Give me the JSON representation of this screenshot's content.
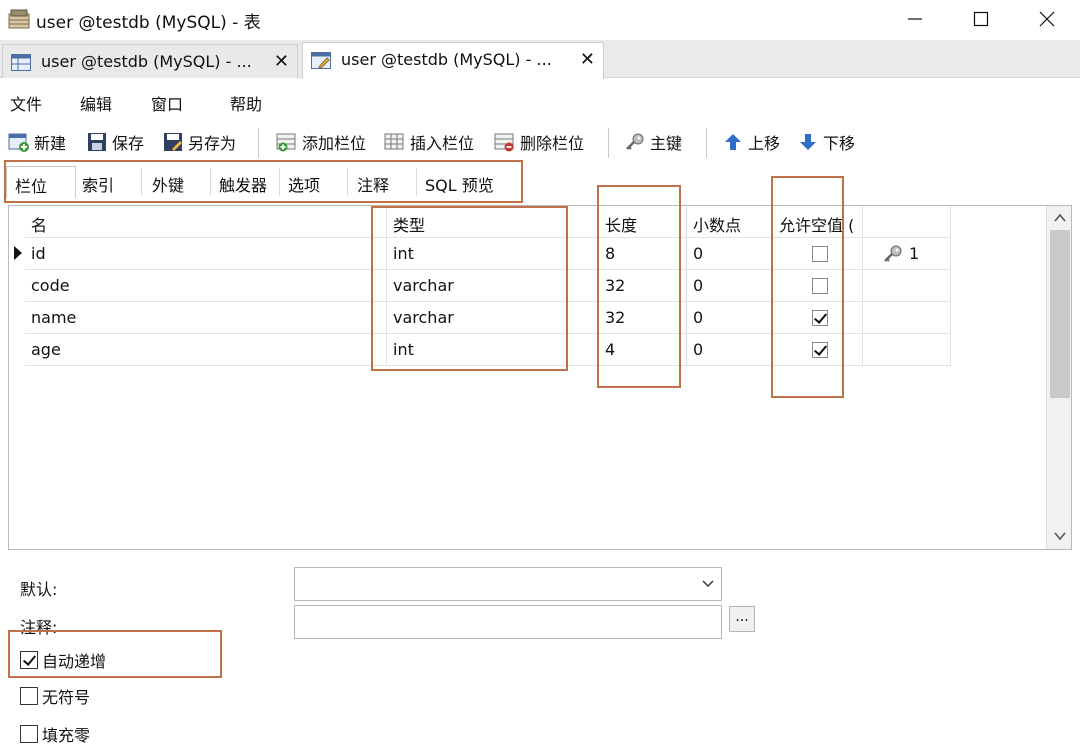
{
  "window": {
    "title": "user @testdb (MySQL) - 表"
  },
  "tabs": [
    {
      "label": "user @testdb (MySQL) - ...",
      "close": "✕"
    },
    {
      "label": "user @testdb (MySQL) - ...",
      "close": "✕"
    }
  ],
  "menu": [
    "文件",
    "编辑",
    "窗口",
    "帮助"
  ],
  "toolbar": {
    "new": "新建",
    "save": "保存",
    "save_as": "另存为",
    "add_column": "添加栏位",
    "insert_column": "插入栏位",
    "delete_column": "删除栏位",
    "primary_key": "主键",
    "move_up": "上移",
    "move_down": "下移"
  },
  "subtabs": [
    "栏位",
    "索引",
    "外键",
    "触发器",
    "选项",
    "注释",
    "SQL 预览"
  ],
  "grid": {
    "headers": [
      "名",
      "类型",
      "长度",
      "小数点",
      "允许空值 ("
    ],
    "rows": [
      {
        "name": "id",
        "type": "int",
        "length": "8",
        "decimals": "0",
        "nullable": false,
        "key": "1"
      },
      {
        "name": "code",
        "type": "varchar",
        "length": "32",
        "decimals": "0",
        "nullable": false,
        "key": ""
      },
      {
        "name": "name",
        "type": "varchar",
        "length": "32",
        "decimals": "0",
        "nullable": true,
        "key": ""
      },
      {
        "name": "age",
        "type": "int",
        "length": "4",
        "decimals": "0",
        "nullable": true,
        "key": ""
      }
    ]
  },
  "props": {
    "default_label": "默认:",
    "comment_label": "注释:",
    "ellipsis": "...",
    "options": [
      {
        "label": "自动递增",
        "checked": true
      },
      {
        "label": "无符号",
        "checked": false
      },
      {
        "label": "填充零",
        "checked": false
      }
    ]
  },
  "colors": {
    "highlight": "#c0714a",
    "window_bg": "#ffffff",
    "tabbar_bg": "#eaeaea"
  }
}
